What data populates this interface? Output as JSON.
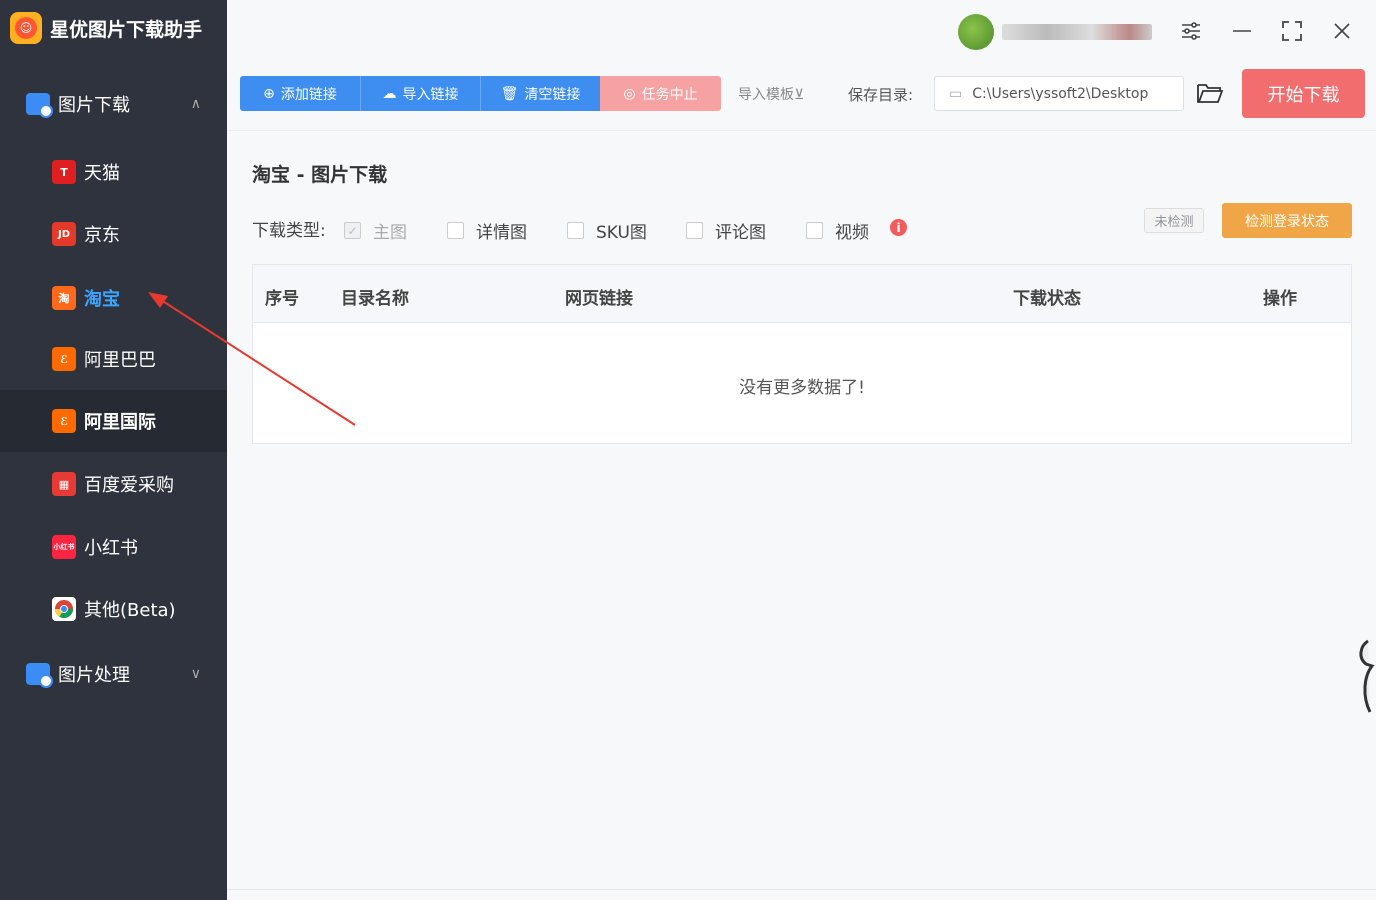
{
  "app": {
    "title": "星优图片下载助手"
  },
  "sidebar": {
    "group_download": {
      "label": "图片下载",
      "chevron": "∧"
    },
    "items": [
      {
        "label": "天猫",
        "icon": "T",
        "color": "#e02020"
      },
      {
        "label": "京东",
        "icon": "JD",
        "color": "#e43a2a"
      },
      {
        "label": "淘宝",
        "icon": "淘",
        "color": "#ff6a1a"
      },
      {
        "label": "阿里巴巴",
        "icon": "ℰ",
        "color": "#ff6a00"
      },
      {
        "label": "阿里国际",
        "icon": "ℰ",
        "color": "#ff6a00"
      },
      {
        "label": "百度爱采购",
        "icon": "▦",
        "color": "#e83a35"
      },
      {
        "label": "小红书",
        "icon": "小红书",
        "color": "#ff2442"
      },
      {
        "label": "其他(Beta)",
        "icon": "chrome-icon",
        "color": "#ffffff"
      }
    ],
    "group_process": {
      "label": "图片处理",
      "chevron": "∨"
    }
  },
  "toolbar": {
    "add_link": "添加链接",
    "import_link": "导入链接",
    "clear_link": "清空链接",
    "stop_task": "任务中止",
    "import_template": "导入模板⊻",
    "save_dir_label": "保存目录:",
    "save_dir_value": "C:\\Users\\yssoft2\\Desktop",
    "start_download": "开始下载"
  },
  "main": {
    "title": "淘宝 - 图片下载",
    "download_type_label": "下载类型:",
    "types": [
      {
        "label": "主图",
        "checked": true,
        "disabled": true
      },
      {
        "label": "详情图",
        "checked": false
      },
      {
        "label": "SKU图",
        "checked": false
      },
      {
        "label": "评论图",
        "checked": false
      },
      {
        "label": "视频",
        "checked": false
      }
    ],
    "login_status_badge": "未检测",
    "check_login_button": "检测登录状态",
    "table": {
      "headers": [
        "序号",
        "目录名称",
        "网页链接",
        "下载状态",
        "操作"
      ],
      "empty_text": "没有更多数据了!"
    }
  }
}
